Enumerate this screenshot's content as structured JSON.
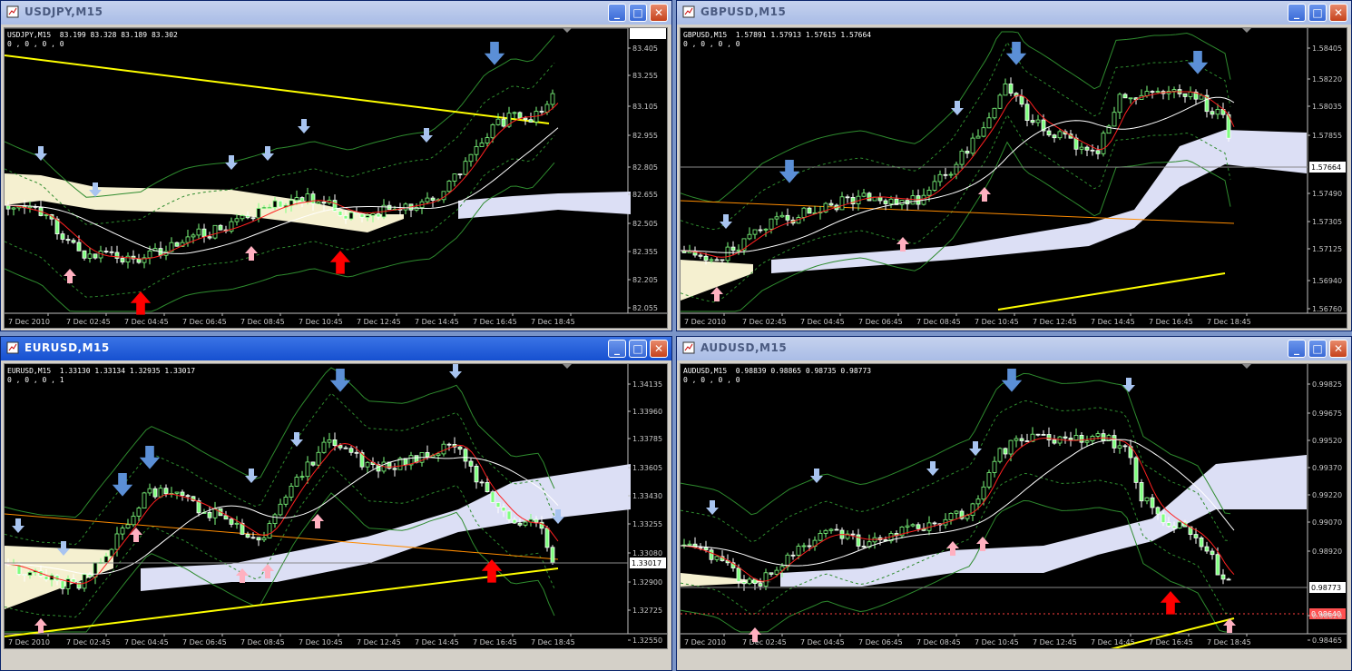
{
  "windows": [
    {
      "id": "usdjpy",
      "title": "USDJPY,M15",
      "active": false,
      "symbol_line": "USDJPY,M15  83.199 83.328 83.189 83.302",
      "indicator_line": "0 , 0 , 0 , 0",
      "price_labels": [
        "83.405",
        "83.255",
        "83.105",
        "82.955",
        "82.805",
        "82.655",
        "82.505",
        "82.355",
        "82.205",
        "82.055"
      ],
      "current_price": "83.302",
      "time_labels": [
        "7 Dec 2010",
        "7 Dec 02:45",
        "7 Dec 04:45",
        "7 Dec 06:45",
        "7 Dec 08:45",
        "7 Dec 10:45",
        "7 Dec 12:45",
        "7 Dec 14:45",
        "7 Dec 16:45",
        "7 Dec 18:45"
      ]
    },
    {
      "id": "gbpusd",
      "title": "GBPUSD,M15",
      "active": false,
      "symbol_line": "GBPUSD,M15  1.57891 1.57913 1.57615 1.57664",
      "indicator_line": "0 , 0 , 0 , 0",
      "price_labels": [
        "1.58405",
        "1.58220",
        "1.58035",
        "1.57855",
        "1.57664",
        "1.57490",
        "1.57305",
        "1.57125",
        "1.56940",
        "1.56760"
      ],
      "current_price": "1.57664",
      "time_labels": [
        "7 Dec 2010",
        "7 Dec 02:45",
        "7 Dec 04:45",
        "7 Dec 06:45",
        "7 Dec 08:45",
        "7 Dec 10:45",
        "7 Dec 12:45",
        "7 Dec 14:45",
        "7 Dec 16:45",
        "7 Dec 18:45"
      ]
    },
    {
      "id": "eurusd",
      "title": "EURUSD,M15",
      "active": true,
      "symbol_line": "EURUSD,M15  1.33130 1.33134 1.32935 1.33017",
      "indicator_line": "0 , 0 , 0 , 1",
      "price_labels": [
        "1.34135",
        "1.33960",
        "1.33785",
        "1.33605",
        "1.33430",
        "1.33255",
        "1.33080",
        "1.33017",
        "1.32900",
        "1.32725",
        "1.32550"
      ],
      "current_price": "1.33017",
      "time_labels": [
        "7 Dec 2010",
        "7 Dec 02:45",
        "7 Dec 04:45",
        "7 Dec 06:45",
        "7 Dec 08:45",
        "7 Dec 10:45",
        "7 Dec 12:45",
        "7 Dec 14:45",
        "7 Dec 16:45",
        "7 Dec 18:45"
      ]
    },
    {
      "id": "audusd",
      "title": "AUDUSD,M15",
      "active": false,
      "symbol_line": "AUDUSD,M15  0.98839 0.98865 0.98735 0.98773",
      "indicator_line": "0 , 0 , 0 , 0",
      "price_labels": [
        "0.99825",
        "0.99675",
        "0.99520",
        "0.99370",
        "0.99220",
        "0.99070",
        "0.98920",
        "0.98773",
        "0.98620",
        "0.98465"
      ],
      "current_price": "0.98773",
      "alert_price": "0.98640",
      "time_labels": [
        "7 Dec 2010",
        "7 Dec 02:45",
        "7 Dec 04:45",
        "7 Dec 06:45",
        "7 Dec 08:45",
        "7 Dec 10:45",
        "7 Dec 12:45",
        "7 Dec 14:45",
        "7 Dec 16:45",
        "7 Dec 18:45"
      ]
    }
  ],
  "colors": {
    "bull": "#7fff7f",
    "bear": "#ffffff",
    "cloud_bull": "#f5f0d0",
    "cloud_bear": "#dcdff5",
    "ma_yellow": "#ffff00",
    "ma_red": "#ff2020",
    "arrow_red": "#ff0000",
    "arrow_blue": "#5b8fd6",
    "arrow_pink": "#ffb0c0"
  }
}
